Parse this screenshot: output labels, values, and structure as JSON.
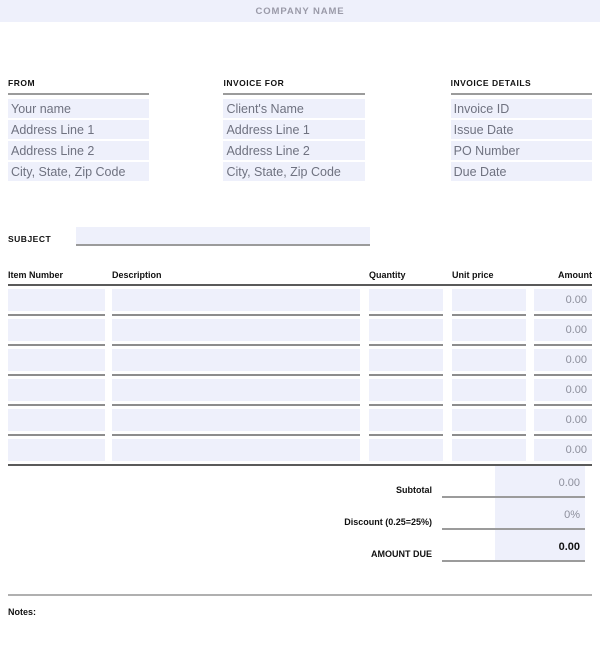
{
  "header": {
    "company_name": "COMPANY NAME"
  },
  "parties": [
    {
      "heading": "FROM",
      "fields": [
        "Your name",
        "Address Line 1",
        "Address Line 2",
        "City, State, Zip Code"
      ]
    },
    {
      "heading": "INVOICE FOR",
      "fields": [
        "Client's Name",
        "Address Line 1",
        "Address Line 2",
        "City, State, Zip Code"
      ]
    },
    {
      "heading": "INVOICE DETAILS",
      "fields": [
        "Invoice ID",
        "Issue Date",
        "PO Number",
        "Due Date"
      ]
    }
  ],
  "subject": {
    "label": "SUBJECT",
    "value": ""
  },
  "items_table": {
    "columns": [
      "Item Number",
      "Description",
      "Quantity",
      "Unit price",
      "Amount"
    ],
    "rows": [
      {
        "item_number": "",
        "description": "",
        "quantity": "",
        "unit_price": "",
        "amount": "0.00"
      },
      {
        "item_number": "",
        "description": "",
        "quantity": "",
        "unit_price": "",
        "amount": "0.00"
      },
      {
        "item_number": "",
        "description": "",
        "quantity": "",
        "unit_price": "",
        "amount": "0.00"
      },
      {
        "item_number": "",
        "description": "",
        "quantity": "",
        "unit_price": "",
        "amount": "0.00"
      },
      {
        "item_number": "",
        "description": "",
        "quantity": "",
        "unit_price": "",
        "amount": "0.00"
      },
      {
        "item_number": "",
        "description": "",
        "quantity": "",
        "unit_price": "",
        "amount": "0.00"
      }
    ]
  },
  "totals": [
    {
      "label": "Subtotal",
      "value": "0.00"
    },
    {
      "label": "Discount (0.25=25%)",
      "value": "0%"
    },
    {
      "label": "AMOUNT DUE",
      "value": "0.00"
    }
  ],
  "notes": {
    "label": "Notes:",
    "value": ""
  },
  "colors": {
    "field_fill": "#eef0fb",
    "header_band": "#eef0fb",
    "placeholder_text": "#6f7280",
    "rule_dark": "#5a5a5a",
    "rule_light": "#9b9b9b"
  }
}
